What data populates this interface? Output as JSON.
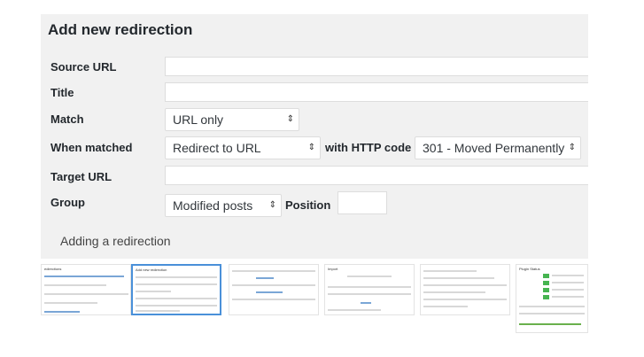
{
  "panel": {
    "title": "Add new redirection",
    "labels": {
      "source_url": "Source URL",
      "title": "Title",
      "match": "Match",
      "when_matched": "When matched",
      "target_url": "Target URL",
      "group": "Group"
    },
    "match_select": "URL only",
    "action_select": "Redirect to URL",
    "http_code_label": "with HTTP code",
    "http_code_select": "301 - Moved Permanently",
    "group_select": "Modified posts",
    "position_label": "Position"
  },
  "caption": "Adding a redirection",
  "thumbnails": [
    {
      "title": "edirections",
      "active": false
    },
    {
      "title": "Add new redirection",
      "active": true
    },
    {
      "title": "",
      "active": false
    },
    {
      "title": "Import",
      "active": false
    },
    {
      "title": "",
      "active": false
    },
    {
      "title": "Plugin Status",
      "active": false
    }
  ],
  "colors": {
    "panel_bg": "#f1f1f1",
    "active_thumb_border": "#4a90d9",
    "text": "#23282d"
  }
}
